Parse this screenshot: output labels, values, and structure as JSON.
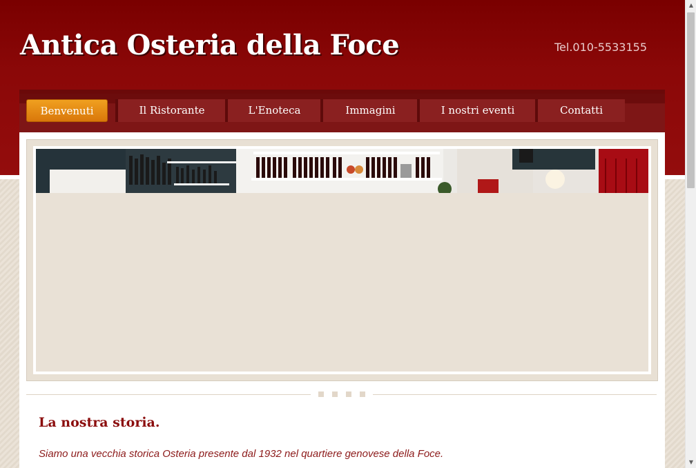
{
  "header": {
    "title": "Antica Osteria della Foce",
    "phone": "Tel.010-5533155"
  },
  "nav": {
    "items": [
      {
        "label": "Benvenuti",
        "active": true
      },
      {
        "label": "Il Ristorante",
        "active": false
      },
      {
        "label": "L'Enoteca",
        "active": false
      },
      {
        "label": "Immagini",
        "active": false
      },
      {
        "label": "I nostri eventi",
        "active": false
      },
      {
        "label": "Contatti",
        "active": false
      }
    ]
  },
  "main": {
    "section_title": "La nostra storia.",
    "intro_text": "Siamo una vecchia storica Osteria presente dal 1932 nel quartiere genovese della Foce."
  },
  "colors": {
    "header_bg": "#8b0808",
    "nav_active": "#e8890f",
    "title_text": "#8b0d0d",
    "page_bg": "#e8e0d4"
  },
  "icons": {
    "scroll_up": "scroll-up-arrow-icon",
    "scroll_down": "scroll-down-arrow-icon"
  }
}
